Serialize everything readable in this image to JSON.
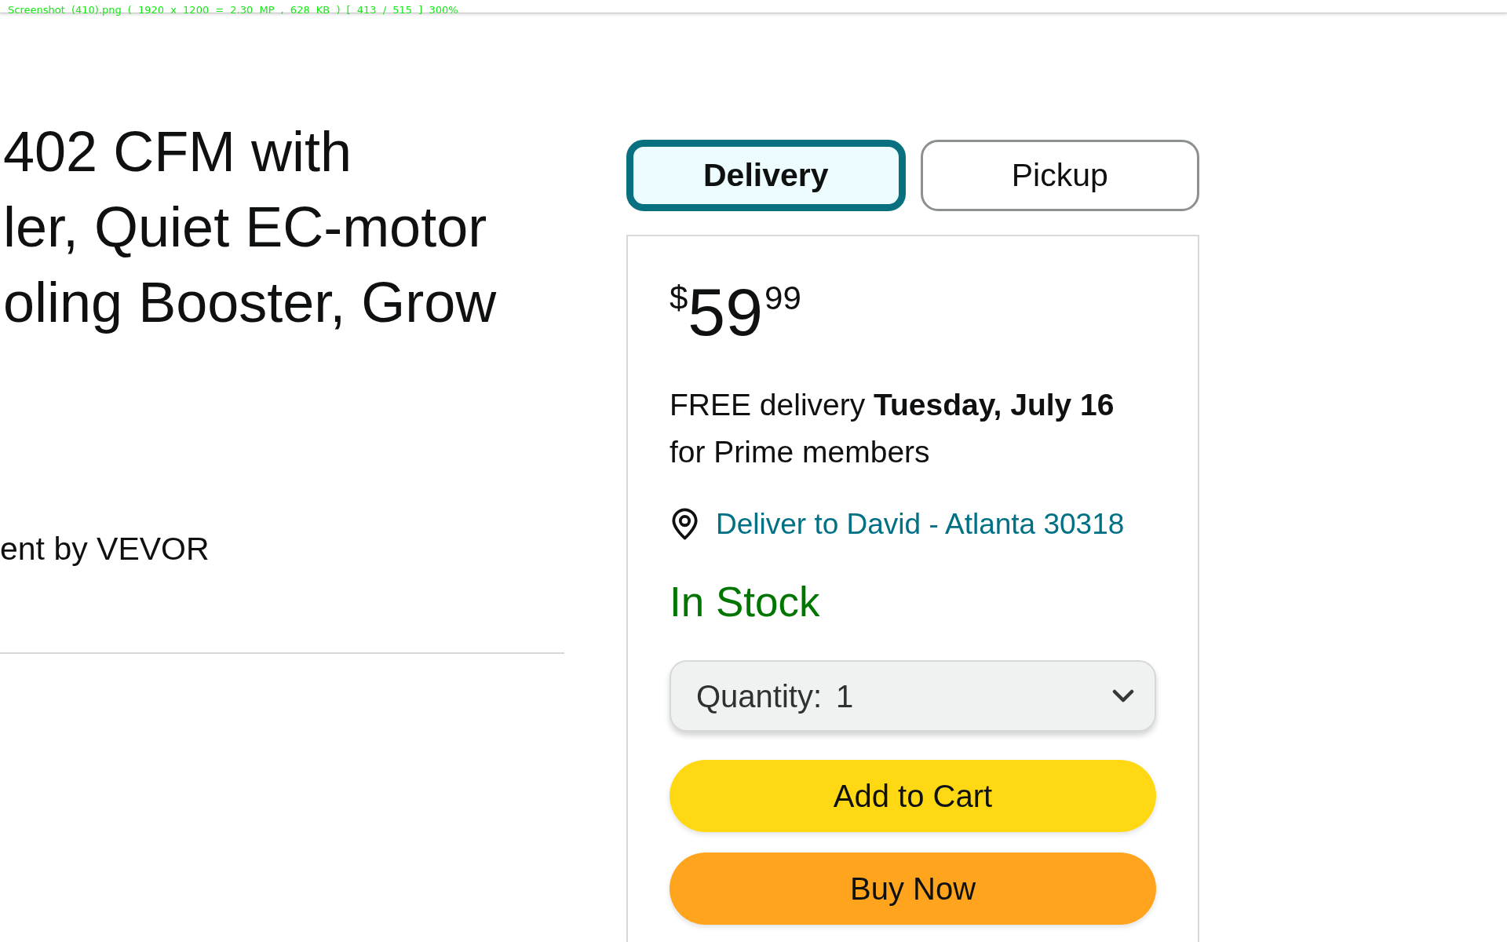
{
  "viewer_bar": {
    "caption": "Screenshot (410).png ( 1920 x 1200 = 2.30 MP , 628 KB ) [ 413 / 515 ] 300%"
  },
  "product": {
    "title_lines": [
      "402 CFM with",
      "ler, Quiet EC-motor",
      "oling Booster, Grow"
    ],
    "byline": "ent by VEVOR"
  },
  "buy_box": {
    "tabs": [
      {
        "label": "Delivery",
        "selected": true
      },
      {
        "label": "Pickup",
        "selected": false
      }
    ],
    "price": {
      "currency": "$",
      "whole": "59",
      "fraction": "99"
    },
    "delivery_message": "FREE delivery **Tuesday, July 16** for Prime members",
    "deliver_to": "Deliver to David - Atlanta 30318",
    "availability": "In Stock",
    "quantity": {
      "label": "Quantity:",
      "value": "1"
    },
    "buttons": [
      {
        "label": "Add to Cart",
        "kind": "cart"
      },
      {
        "label": "Buy Now",
        "kind": "buy"
      }
    ]
  }
}
